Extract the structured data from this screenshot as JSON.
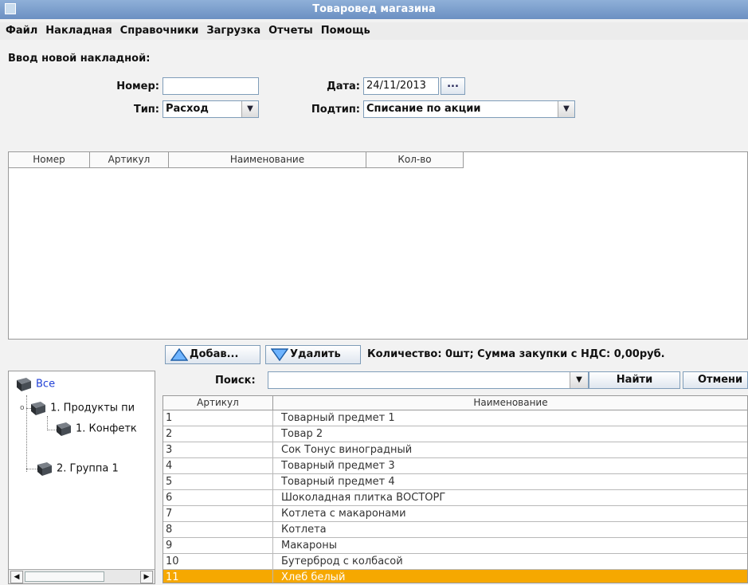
{
  "window": {
    "title": "Товаровед магазина"
  },
  "menu": [
    "Файл",
    "Накладная",
    "Справочники",
    "Загрузка",
    "Отчеты",
    "Помощь"
  ],
  "form": {
    "section_title": "Ввод новой накладной:",
    "number_label": "Номер:",
    "number_value": "",
    "date_label": "Дата:",
    "date_value": "24/11/2013",
    "date_button": "...",
    "type_label": "Тип:",
    "type_value": "Расход",
    "subtype_label": "Подтип:",
    "subtype_value": "Списание по акции"
  },
  "invoice_table": {
    "columns": [
      "Номер",
      "Артикул",
      "Наименование",
      "Кол-во"
    ],
    "rows": []
  },
  "actions": {
    "add_label": "Добав...",
    "delete_label": "Удалить",
    "summary": "Количество: 0шт; Сумма закупки с НДС: 0,00руб."
  },
  "tree": {
    "root": "Все",
    "nodes": [
      "1. Продукты пи",
      "1. Конфетк",
      "2. Группа 1"
    ]
  },
  "search": {
    "label": "Поиск:",
    "value": "",
    "find_label": "Найти",
    "cancel_label": "Отмени"
  },
  "products": {
    "columns": [
      "Артикул",
      "Наименование"
    ],
    "rows": [
      {
        "article": "1",
        "name": "Товарный предмет 1"
      },
      {
        "article": "2",
        "name": "Товар 2"
      },
      {
        "article": "3",
        "name": "Сок Тонус виноградный"
      },
      {
        "article": "4",
        "name": "Товарный предмет 3"
      },
      {
        "article": "5",
        "name": "Товарный предмет 4"
      },
      {
        "article": "6",
        "name": "Шоколадная плитка ВОСТОРГ"
      },
      {
        "article": "7",
        "name": "Котлета с макаронами"
      },
      {
        "article": "8",
        "name": "Котлета"
      },
      {
        "article": "9",
        "name": "Макароны"
      },
      {
        "article": "10",
        "name": "Бутерброд с колбасой"
      },
      {
        "article": "11",
        "name": "Хлеб белый"
      }
    ],
    "selected_row": "11"
  },
  "colors": {
    "titlebar": "#7a9ccb",
    "selection": "#f6a800",
    "tree_link": "#1f3fd6"
  }
}
